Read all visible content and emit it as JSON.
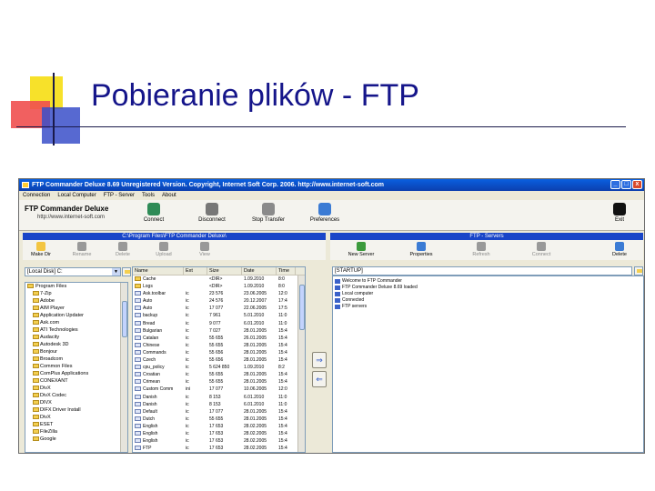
{
  "slide": {
    "title": "Pobieranie plików - FTP"
  },
  "app": {
    "window_title": "FTP Commander Deluxe 8.69 Unregistered Version. Copyright, Internet Soft Corp. 2006. http://www.internet-soft.com",
    "window_buttons": [
      "_",
      "□",
      "x"
    ],
    "menu": [
      "Connection",
      "Local Computer",
      "FTP - Server",
      "Tools",
      "About"
    ],
    "brand": {
      "name": "FTP Commander Deluxe",
      "url": "http://www.internet-soft.com"
    },
    "toolbar": [
      {
        "label": "Connect",
        "icon": "connect-icon",
        "color": "#2e8b57"
      },
      {
        "label": "Disconnect",
        "icon": "disconnect-icon",
        "color": "#777777"
      },
      {
        "label": "Stop Transfer",
        "icon": "stop-transfer-icon",
        "color": "#8a8a8a"
      },
      {
        "label": "Preferences",
        "icon": "preferences-icon",
        "color": "#3b7bd4"
      },
      {
        "label": "Exit",
        "icon": "exit-icon",
        "color": "#111111"
      }
    ],
    "left_panel": {
      "header": "C:\\Program Files\\FTP Commander Deluxe\\",
      "buttons": [
        {
          "label": "Make Dir",
          "icon": "make-dir-icon",
          "color": "#f3c541"
        },
        {
          "label": "Rename",
          "icon": "rename-icon",
          "color": "#999999"
        },
        {
          "label": "Delete",
          "icon": "delete-icon",
          "color": "#999999"
        },
        {
          "label": "Upload",
          "icon": "upload-icon",
          "color": "#999999"
        },
        {
          "label": "View",
          "icon": "view-icon",
          "color": "#999999"
        }
      ],
      "drive": "[Local Disk] C:",
      "tree": [
        "Program Files",
        "7-Zip",
        "Adobe",
        "AIM Player",
        "Application Updater",
        "Ask.com",
        "ATI Technologies",
        "Audacity",
        "Autodesk 3D",
        "Bonjour",
        "Broadcom",
        "Common Files",
        "ComPlus Applications",
        "CONEXANT",
        "DivX",
        "DivX Codec",
        "DIVX",
        "DIFX Driver Install",
        "DivX",
        "ESET",
        "FileZilla",
        "Google"
      ],
      "columns": [
        "Name",
        "Ext",
        "Size",
        "Date",
        "Time"
      ],
      "files": [
        {
          "name": "Cache",
          "ext": "",
          "size": "<DIR>",
          "date": "1.09.2010",
          "time": "8:0",
          "type": "folder"
        },
        {
          "name": "Logs",
          "ext": "",
          "size": "<DIR>",
          "date": "1.09.2010",
          "time": "8:0",
          "type": "folder"
        },
        {
          "name": "Ask.toolbar",
          "ext": "ic",
          "size": "23 576",
          "date": "23.06.2005",
          "time": "12:0",
          "type": "file"
        },
        {
          "name": "Auto",
          "ext": "ic",
          "size": "24 576",
          "date": "20.12.2007",
          "time": "17:4",
          "type": "file"
        },
        {
          "name": "Auto",
          "ext": "ic",
          "size": "17 077",
          "date": "22.06.2005",
          "time": "17:5",
          "type": "file"
        },
        {
          "name": "backup",
          "ext": "ic",
          "size": "7 961",
          "date": "5.01.2010",
          "time": "11:0",
          "type": "file"
        },
        {
          "name": "Bread",
          "ext": "ic",
          "size": "9 077",
          "date": "6.01.2010",
          "time": "11:0",
          "type": "file"
        },
        {
          "name": "Bulgarian",
          "ext": "ic",
          "size": "7 027",
          "date": "28.01.2005",
          "time": "15:4",
          "type": "file"
        },
        {
          "name": "Catalan",
          "ext": "ic",
          "size": "55 655",
          "date": "26.01.2005",
          "time": "15:4",
          "type": "file"
        },
        {
          "name": "Chinese",
          "ext": "ic",
          "size": "55 655",
          "date": "28.01.2005",
          "time": "15:4",
          "type": "file"
        },
        {
          "name": "Commands",
          "ext": "ic",
          "size": "55 656",
          "date": "28.01.2005",
          "time": "15:4",
          "type": "file"
        },
        {
          "name": "Czech",
          "ext": "ic",
          "size": "55 656",
          "date": "28.01.2005",
          "time": "15:4",
          "type": "file"
        },
        {
          "name": "cpu_policy",
          "ext": "ic",
          "size": "5 624 850",
          "date": "1.09.2010",
          "time": "8:2",
          "type": "file"
        },
        {
          "name": "Croatian",
          "ext": "ic",
          "size": "55 655",
          "date": "28.01.2005",
          "time": "15:4",
          "type": "file"
        },
        {
          "name": "Crimean",
          "ext": "ic",
          "size": "55 655",
          "date": "28.01.2005",
          "time": "15:4",
          "type": "file"
        },
        {
          "name": "Custom Comm",
          "ext": "ini",
          "size": "17 077",
          "date": "10.06.2005",
          "time": "12:0",
          "type": "file"
        },
        {
          "name": "Danish",
          "ext": "ic",
          "size": "8 153",
          "date": "6.01.2010",
          "time": "11:0",
          "type": "file"
        },
        {
          "name": "Danish",
          "ext": "ic",
          "size": "8 153",
          "date": "6.01.2010",
          "time": "11:0",
          "type": "file"
        },
        {
          "name": "Default",
          "ext": "ic",
          "size": "17 077",
          "date": "28.01.2005",
          "time": "15:4",
          "type": "file"
        },
        {
          "name": "Dutch",
          "ext": "ic",
          "size": "55 655",
          "date": "28.01.2005",
          "time": "15:4",
          "type": "file"
        },
        {
          "name": "English",
          "ext": "ic",
          "size": "17 653",
          "date": "28.02.2005",
          "time": "15:4",
          "type": "file"
        },
        {
          "name": "English",
          "ext": "ic",
          "size": "17 653",
          "date": "28.02.2005",
          "time": "15:4",
          "type": "file"
        },
        {
          "name": "English",
          "ext": "ic",
          "size": "17 653",
          "date": "28.02.2005",
          "time": "15:4",
          "type": "file"
        },
        {
          "name": "FTP",
          "ext": "ic",
          "size": "17 653",
          "date": "28.02.2005",
          "time": "15:4",
          "type": "file"
        }
      ]
    },
    "transfer_buttons": [
      "⇒",
      "⇐"
    ],
    "right_panel": {
      "header": "FTP - Servers",
      "buttons": [
        {
          "label": "New Server",
          "icon": "new-server-icon",
          "color": "#3c9a3c"
        },
        {
          "label": "Properties",
          "icon": "properties-icon",
          "color": "#3b7bd4"
        },
        {
          "label": "Refresh",
          "icon": "refresh-icon",
          "color": "#999999"
        },
        {
          "label": "Connect",
          "icon": "connect-server-icon",
          "color": "#999999"
        },
        {
          "label": "Delete",
          "icon": "delete-server-icon",
          "color": "#3b7bd4"
        }
      ],
      "path": "[STARTUP]",
      "log": [
        "Welcome to FTP Commander",
        "FTP Commander Deluxe 8.69 loaded",
        "Local computer",
        "Connected",
        "FTP servers"
      ]
    }
  }
}
